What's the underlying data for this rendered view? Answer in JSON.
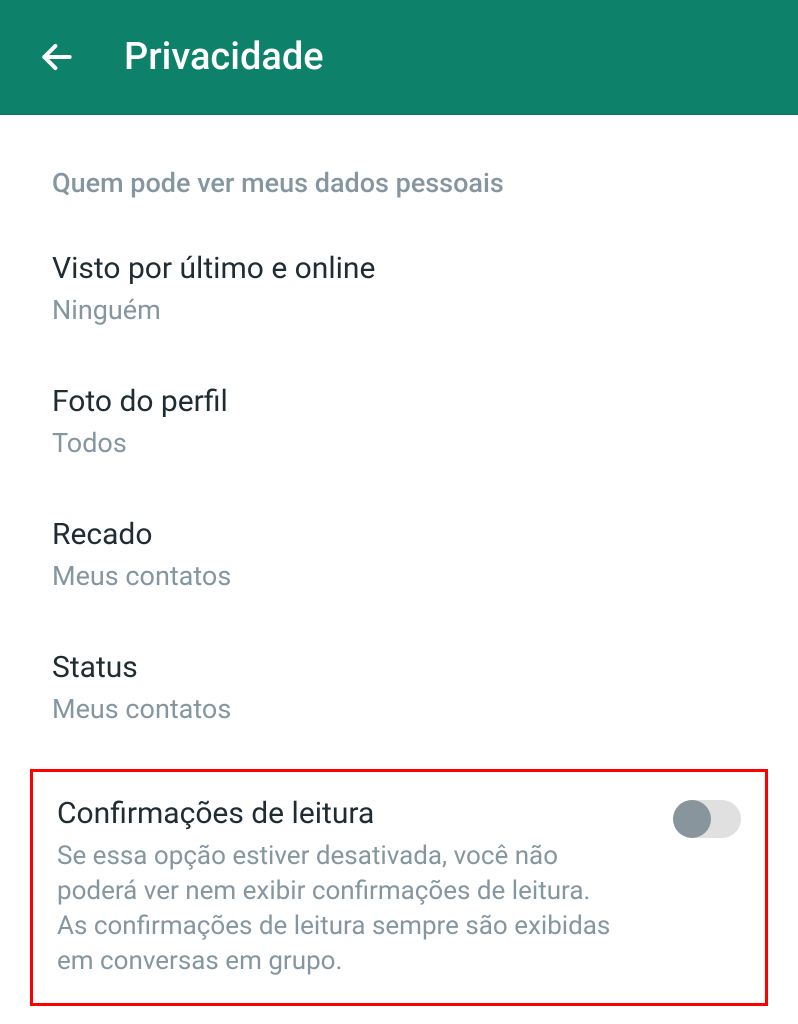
{
  "header": {
    "title": "Privacidade"
  },
  "section": {
    "header": "Quem pode ver meus dados pessoais"
  },
  "settings": {
    "lastSeen": {
      "title": "Visto por último e online",
      "value": "Ninguém"
    },
    "profilePhoto": {
      "title": "Foto do perfil",
      "value": "Todos"
    },
    "about": {
      "title": "Recado",
      "value": "Meus contatos"
    },
    "status": {
      "title": "Status",
      "value": "Meus contatos"
    },
    "readReceipts": {
      "title": "Confirmações de leitura",
      "description": "Se essa opção estiver desativada, você não poderá ver nem exibir confirmações de leitura. As confirmações de leitura sempre são exibidas em conversas em grupo."
    }
  }
}
